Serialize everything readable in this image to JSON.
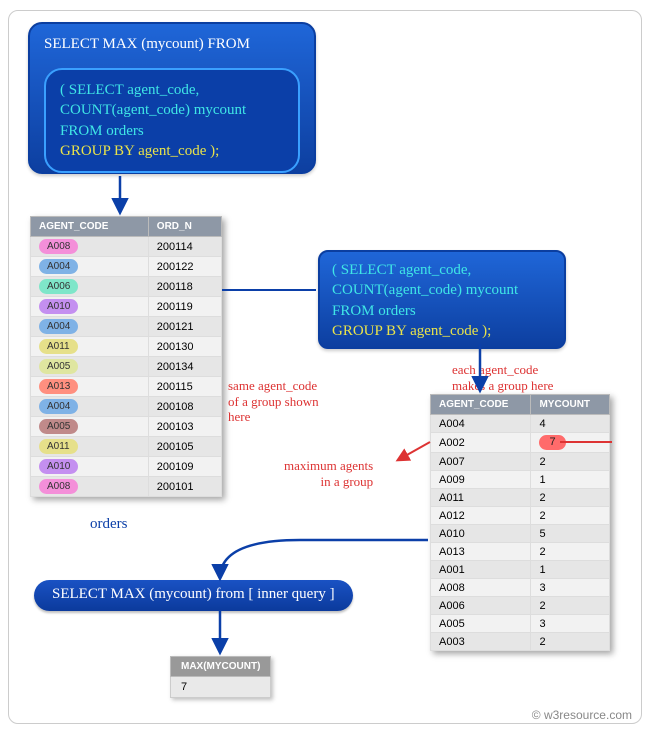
{
  "outer_query": {
    "line1": "SELECT MAX (mycount) FROM"
  },
  "inner_query": {
    "l1": "( SELECT agent_code,",
    "l2": "COUNT(agent_code) mycount",
    "l3": "FROM orders",
    "l4": "GROUP BY agent_code );"
  },
  "inner_query_repeat": {
    "l1": "( SELECT agent_code,",
    "l2": "COUNT(agent_code) mycount",
    "l3": "FROM orders",
    "l4": "GROUP BY agent_code );"
  },
  "oval_label": "SELECT MAX (mycount) from [ inner query ]",
  "notes": {
    "same_group_1": "same agent_code",
    "same_group_2": "of a group shown",
    "same_group_3": "here",
    "each_group_1": "each agent_code",
    "each_group_2": "makes a group here",
    "max_1": "maximum agents",
    "max_2": "in a group"
  },
  "captions": {
    "orders": "orders"
  },
  "orders_table": {
    "headers": [
      "AGENT_CODE",
      "ORD_N"
    ],
    "rows": [
      {
        "agent": "A008",
        "ord": "200114",
        "color": "#f48fd9"
      },
      {
        "agent": "A004",
        "ord": "200122",
        "color": "#7fb2e6"
      },
      {
        "agent": "A006",
        "ord": "200118",
        "color": "#7fe6c9"
      },
      {
        "agent": "A010",
        "ord": "200119",
        "color": "#c48ff0"
      },
      {
        "agent": "A004",
        "ord": "200121",
        "color": "#7fb2e6"
      },
      {
        "agent": "A011",
        "ord": "200130",
        "color": "#e6e08a"
      },
      {
        "agent": "A005",
        "ord": "200134",
        "color": "#dfe6a0"
      },
      {
        "agent": "A013",
        "ord": "200115",
        "color": "#ff8f7f"
      },
      {
        "agent": "A004",
        "ord": "200108",
        "color": "#7fb2e6"
      },
      {
        "agent": "A005",
        "ord": "200103",
        "color": "#c08a8a"
      },
      {
        "agent": "A011",
        "ord": "200105",
        "color": "#e6e08a"
      },
      {
        "agent": "A010",
        "ord": "200109",
        "color": "#c48ff0"
      },
      {
        "agent": "A008",
        "ord": "200101",
        "color": "#f48fd9"
      }
    ]
  },
  "group_table": {
    "headers": [
      "AGENT_CODE",
      "MYCOUNT"
    ],
    "rows": [
      {
        "agent": "A004",
        "cnt": "4",
        "hi": false
      },
      {
        "agent": "A002",
        "cnt": "7",
        "hi": true
      },
      {
        "agent": "A007",
        "cnt": "2",
        "hi": false
      },
      {
        "agent": "A009",
        "cnt": "1",
        "hi": false
      },
      {
        "agent": "A011",
        "cnt": "2",
        "hi": false
      },
      {
        "agent": "A012",
        "cnt": "2",
        "hi": false
      },
      {
        "agent": "A010",
        "cnt": "5",
        "hi": false
      },
      {
        "agent": "A013",
        "cnt": "2",
        "hi": false
      },
      {
        "agent": "A001",
        "cnt": "1",
        "hi": false
      },
      {
        "agent": "A008",
        "cnt": "3",
        "hi": false
      },
      {
        "agent": "A006",
        "cnt": "2",
        "hi": false
      },
      {
        "agent": "A005",
        "cnt": "3",
        "hi": false
      },
      {
        "agent": "A003",
        "cnt": "2",
        "hi": false
      }
    ]
  },
  "result_table": {
    "header": "MAX(MYCOUNT)",
    "value": "7"
  },
  "credit": "© w3resource.com",
  "chart_data": {
    "type": "table",
    "title": "SQL subquery: SELECT MAX(mycount) FROM (SELECT agent_code, COUNT(agent_code) mycount FROM orders GROUP BY agent_code)",
    "orders_sample": [
      [
        "A008",
        "200114"
      ],
      [
        "A004",
        "200122"
      ],
      [
        "A006",
        "200118"
      ],
      [
        "A010",
        "200119"
      ],
      [
        "A004",
        "200121"
      ],
      [
        "A011",
        "200130"
      ],
      [
        "A005",
        "200134"
      ],
      [
        "A013",
        "200115"
      ],
      [
        "A004",
        "200108"
      ],
      [
        "A005",
        "200103"
      ],
      [
        "A011",
        "200105"
      ],
      [
        "A010",
        "200109"
      ],
      [
        "A008",
        "200101"
      ]
    ],
    "grouped_counts": {
      "A004": 4,
      "A002": 7,
      "A007": 2,
      "A009": 1,
      "A011": 2,
      "A012": 2,
      "A010": 5,
      "A013": 2,
      "A001": 1,
      "A008": 3,
      "A006": 2,
      "A005": 3,
      "A003": 2
    },
    "result": {
      "MAX(MYCOUNT)": 7
    }
  }
}
